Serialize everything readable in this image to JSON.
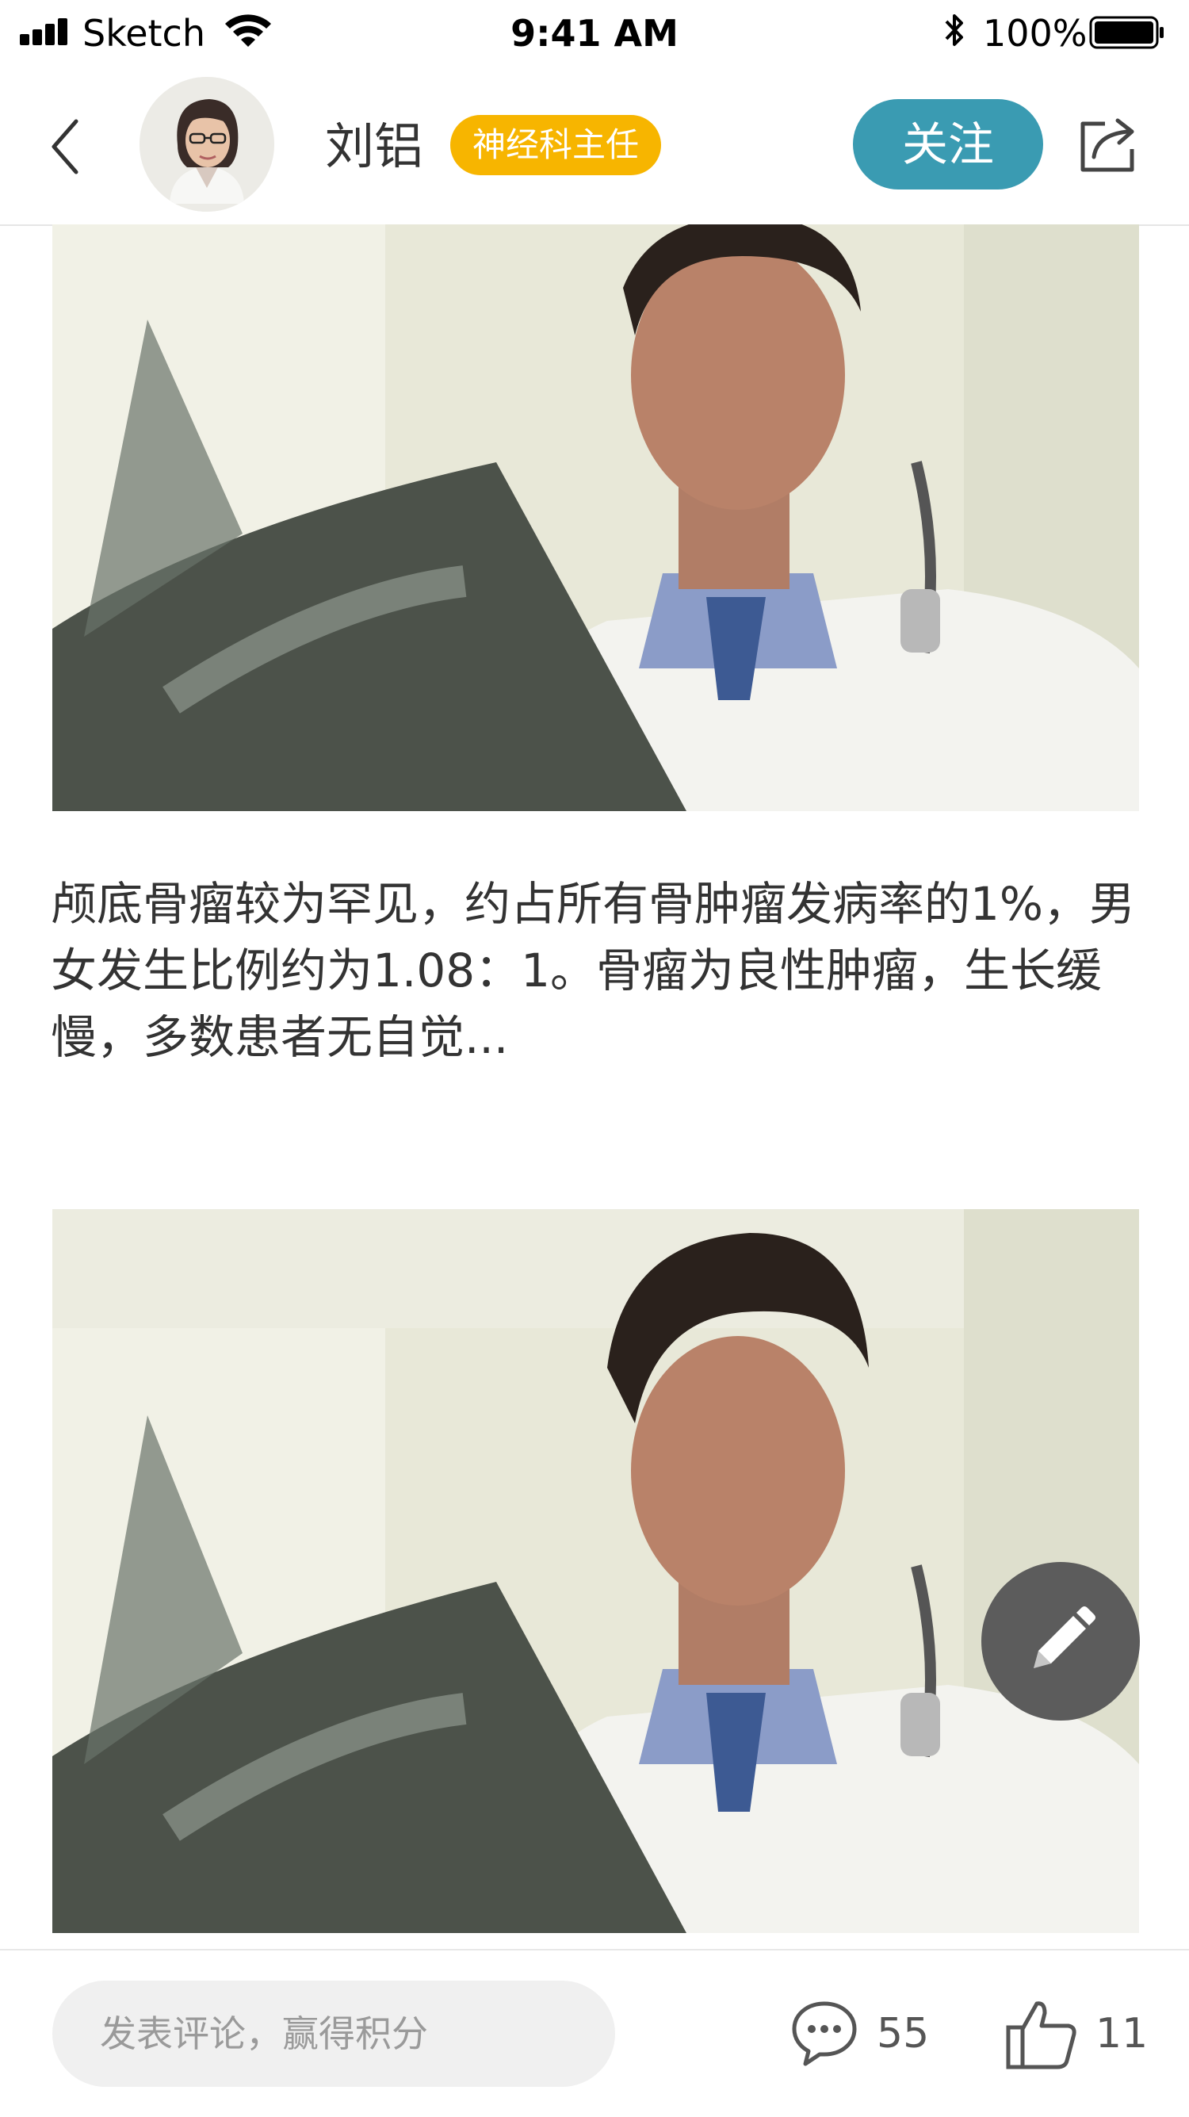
{
  "status_bar": {
    "carrier": "Sketch",
    "time": "9:41 AM",
    "battery": "100%"
  },
  "header": {
    "doctor_name": "刘铝",
    "doctor_title": "神经科主任",
    "follow_label": "关注",
    "icons": [
      "chevron-left-icon",
      "share-icon"
    ]
  },
  "article": {
    "excerpt": "颅底骨瘤较为罕见，约占所有骨肿瘤发病率的1%，男女发生比例约为1.08：1。骨瘤为良性肿瘤，生长缓慢，多数患者无自觉..."
  },
  "bottom_bar": {
    "comment_placeholder": "发表评论，赢得积分",
    "comment_count": "55",
    "like_count": "11"
  },
  "colors": {
    "follow_button": "#3a9bb2",
    "title_badge": "#f7b500",
    "fab": "#5c5c5c"
  }
}
